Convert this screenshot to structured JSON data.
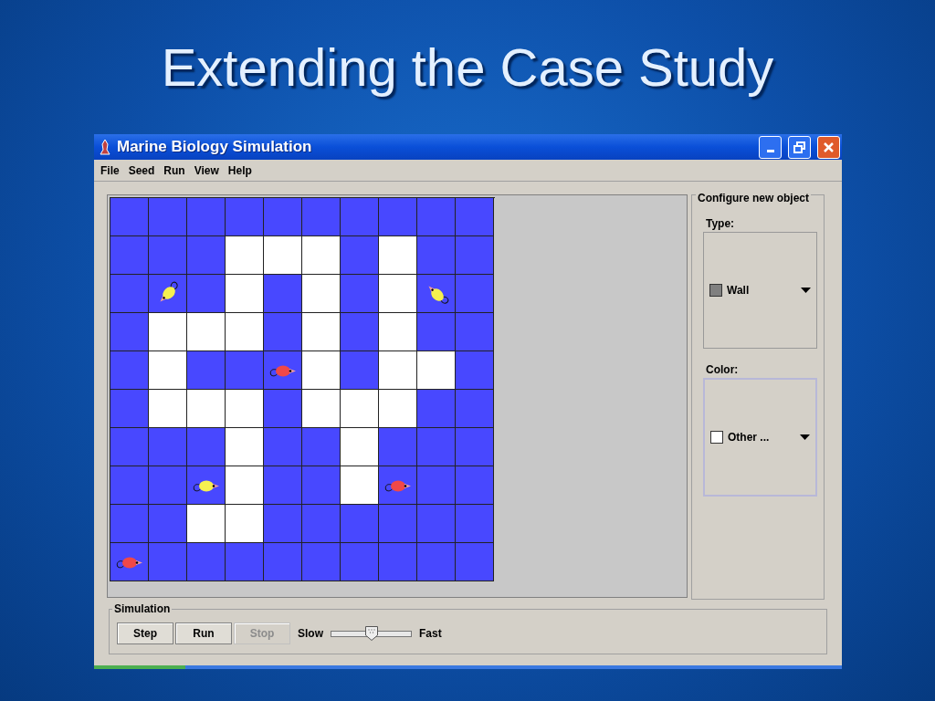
{
  "slide": {
    "title": "Extending the Case Study"
  },
  "window": {
    "title": "Marine Biology Simulation"
  },
  "menu": [
    "File",
    "Seed",
    "Run",
    "View",
    "Help"
  ],
  "grid": {
    "rows": [
      [
        {
          "kind": "water"
        },
        {
          "kind": "water"
        },
        {
          "kind": "water"
        },
        {
          "kind": "water"
        },
        {
          "kind": "water"
        },
        {
          "kind": "water"
        },
        {
          "kind": "water"
        },
        {
          "kind": "water"
        },
        {
          "kind": "water"
        },
        {
          "kind": "water"
        }
      ],
      [
        {
          "kind": "water"
        },
        {
          "kind": "water"
        },
        {
          "kind": "water"
        },
        {
          "kind": "wall"
        },
        {
          "kind": "wall"
        },
        {
          "kind": "wall"
        },
        {
          "kind": "water"
        },
        {
          "kind": "wall"
        },
        {
          "kind": "water"
        },
        {
          "kind": "water"
        }
      ],
      [
        {
          "kind": "water"
        },
        {
          "kind": "fish_southwest",
          "color": "#f5f050"
        },
        {
          "kind": "water"
        },
        {
          "kind": "wall"
        },
        {
          "kind": "water"
        },
        {
          "kind": "wall"
        },
        {
          "kind": "water"
        },
        {
          "kind": "wall"
        },
        {
          "kind": "fish_northwest",
          "color": "#f5f050"
        },
        {
          "kind": "water"
        }
      ],
      [
        {
          "kind": "water"
        },
        {
          "kind": "wall"
        },
        {
          "kind": "wall"
        },
        {
          "kind": "wall"
        },
        {
          "kind": "water"
        },
        {
          "kind": "wall"
        },
        {
          "kind": "water"
        },
        {
          "kind": "wall"
        },
        {
          "kind": "water"
        },
        {
          "kind": "water"
        }
      ],
      [
        {
          "kind": "water"
        },
        {
          "kind": "wall"
        },
        {
          "kind": "water"
        },
        {
          "kind": "water"
        },
        {
          "kind": "fish_east",
          "color": "#f04848"
        },
        {
          "kind": "wall"
        },
        {
          "kind": "water"
        },
        {
          "kind": "wall"
        },
        {
          "kind": "wall"
        },
        {
          "kind": "water"
        }
      ],
      [
        {
          "kind": "water"
        },
        {
          "kind": "wall"
        },
        {
          "kind": "wall"
        },
        {
          "kind": "wall"
        },
        {
          "kind": "water"
        },
        {
          "kind": "wall"
        },
        {
          "kind": "wall"
        },
        {
          "kind": "wall"
        },
        {
          "kind": "water"
        },
        {
          "kind": "water"
        }
      ],
      [
        {
          "kind": "water"
        },
        {
          "kind": "water"
        },
        {
          "kind": "water"
        },
        {
          "kind": "wall"
        },
        {
          "kind": "water"
        },
        {
          "kind": "water"
        },
        {
          "kind": "wall"
        },
        {
          "kind": "water"
        },
        {
          "kind": "water"
        },
        {
          "kind": "water"
        }
      ],
      [
        {
          "kind": "water"
        },
        {
          "kind": "water"
        },
        {
          "kind": "fish_east",
          "color": "#f5f050"
        },
        {
          "kind": "wall"
        },
        {
          "kind": "water"
        },
        {
          "kind": "water"
        },
        {
          "kind": "wall"
        },
        {
          "kind": "fish_east",
          "color": "#f04848"
        },
        {
          "kind": "water"
        },
        {
          "kind": "water"
        }
      ],
      [
        {
          "kind": "water"
        },
        {
          "kind": "water"
        },
        {
          "kind": "wall"
        },
        {
          "kind": "wall"
        },
        {
          "kind": "water"
        },
        {
          "kind": "water"
        },
        {
          "kind": "water"
        },
        {
          "kind": "water"
        },
        {
          "kind": "water"
        },
        {
          "kind": "water"
        }
      ],
      [
        {
          "kind": "fish_east",
          "color": "#f04848"
        },
        {
          "kind": "water"
        },
        {
          "kind": "water"
        },
        {
          "kind": "water"
        },
        {
          "kind": "water"
        },
        {
          "kind": "water"
        },
        {
          "kind": "water"
        },
        {
          "kind": "water"
        },
        {
          "kind": "water"
        },
        {
          "kind": "water"
        }
      ]
    ]
  },
  "configure": {
    "title": "Configure new object",
    "fields": [
      {
        "label": "Type:",
        "value": "Wall",
        "color": "#808080"
      },
      {
        "label": "Color:",
        "value": "Other ...",
        "color": "#ffffff"
      }
    ]
  },
  "simulation": {
    "title": "Simulation",
    "buttons": [
      {
        "label": "Step",
        "disabled": false
      },
      {
        "label": "Run",
        "disabled": false
      },
      {
        "label": "Stop",
        "disabled": true
      }
    ],
    "slow_label": "Slow",
    "fast_label": "Fast",
    "speed": {
      "level": 0.5
    }
  }
}
